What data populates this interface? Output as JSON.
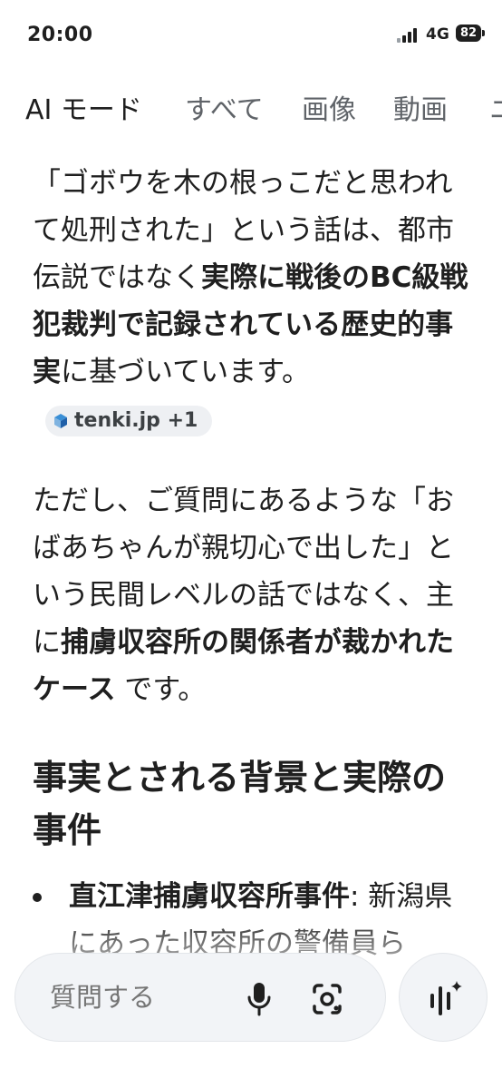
{
  "status_bar": {
    "time": "20:00",
    "network": "4G",
    "battery": "82"
  },
  "tabs": [
    {
      "label": "AI モード",
      "active": true
    },
    {
      "label": "すべて"
    },
    {
      "label": "画像"
    },
    {
      "label": "動画"
    },
    {
      "label": "ニ"
    }
  ],
  "answer": {
    "p1": {
      "t1": "「ゴボウを木の根っこだと思われて処刑された」という話は、都市伝説ではなく",
      "b1": "実際に戦後のBC級戦犯裁判で記録されている歴史的事実",
      "t2": "に基づいています。",
      "source_chip": "tenki.jp +1"
    },
    "p2": {
      "t1": "ただし、ご質問にあるような「おばあちゃんが親切心で出した」という民間レベルの話ではなく、主に",
      "b1": "捕虜収容所の関係者が裁かれたケース",
      "t2": " です。"
    },
    "heading": "事実とされる背景と実際の事件",
    "bullet1": {
      "bold": "直江津捕虜収容所事件",
      "text": ": 新潟県にあった収容所の警備員ら"
    }
  },
  "input_bar": {
    "placeholder": "質問する"
  },
  "colors": {
    "text": "#1f1f1f",
    "muted": "#5f6368",
    "chip_bg": "#eef0f3",
    "bar_bg": "#f2f4f7"
  }
}
